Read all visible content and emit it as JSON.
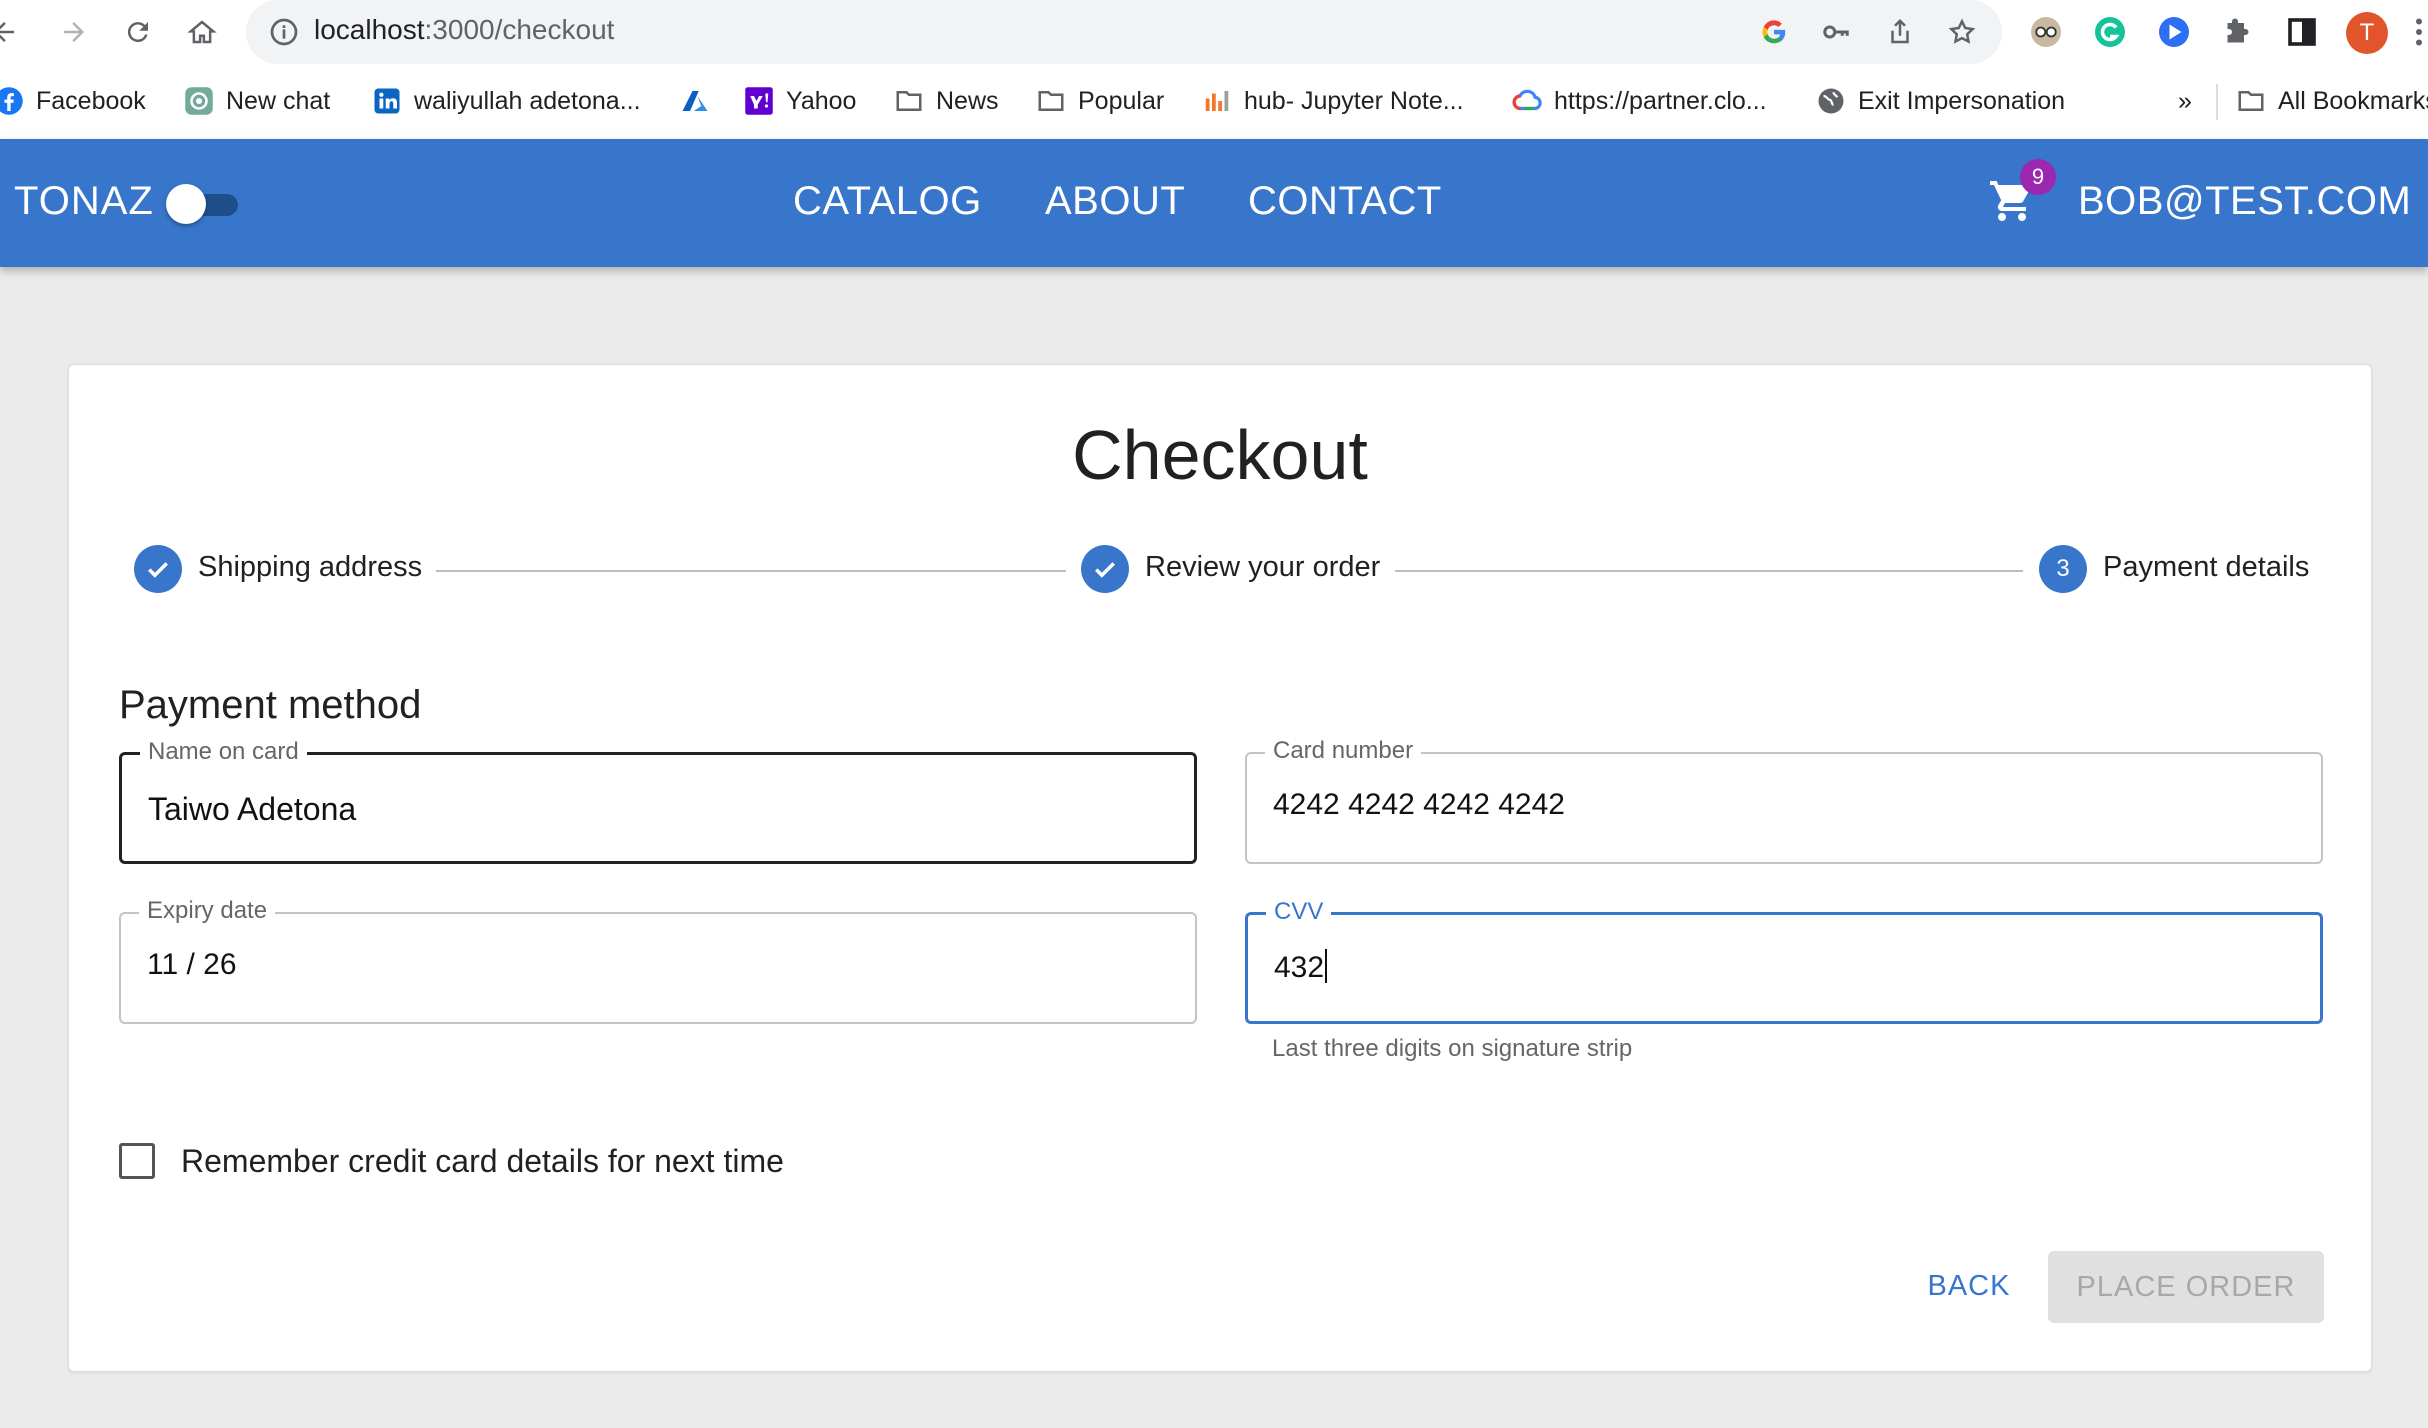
{
  "browser": {
    "url_host": "localhost",
    "url_path": ":3000/checkout",
    "profile_initial": "T",
    "bookmarks": [
      {
        "label": "Facebook",
        "icon": "facebook-icon"
      },
      {
        "label": "New chat",
        "icon": "openai-icon"
      },
      {
        "label": "waliyullah adetona...",
        "icon": "linkedin-icon"
      },
      {
        "label": "",
        "icon": "azure-icon"
      },
      {
        "label": "Yahoo",
        "icon": "yahoo-icon"
      },
      {
        "label": "News",
        "icon": "folder-icon"
      },
      {
        "label": "Popular",
        "icon": "folder-icon"
      },
      {
        "label": "hub- Jupyter Note...",
        "icon": "jupyter-icon"
      },
      {
        "label": "https://partner.clo...",
        "icon": "google-cloud-icon"
      },
      {
        "label": "Exit Impersonation",
        "icon": "globe-icon"
      }
    ],
    "overflow_label": "»",
    "all_bookmarks_label": "All Bookmarks"
  },
  "appbar": {
    "brand": "TONAZ",
    "nav": [
      "CATALOG",
      "ABOUT",
      "CONTACT"
    ],
    "cart_count": "9",
    "user": "BOB@TEST.COM",
    "color": "#3876cc"
  },
  "checkout": {
    "title": "Checkout",
    "steps": [
      {
        "label": "Shipping address",
        "status": "complete"
      },
      {
        "label": "Review your order",
        "status": "complete"
      },
      {
        "label": "Payment details",
        "status": "active",
        "number": "3"
      }
    ],
    "section_title": "Payment method",
    "fields": {
      "name_on_card": {
        "label": "Name on card",
        "value": "Taiwo Adetona"
      },
      "card_number": {
        "label": "Card number",
        "value": "4242 4242 4242 4242"
      },
      "expiry": {
        "label": "Expiry date",
        "value": "11 / 26"
      },
      "cvv": {
        "label": "CVV",
        "value": "432",
        "helper": "Last three digits on signature strip"
      }
    },
    "remember_label": "Remember credit card details for next time",
    "back_label": "BACK",
    "place_order_label": "PLACE ORDER"
  }
}
